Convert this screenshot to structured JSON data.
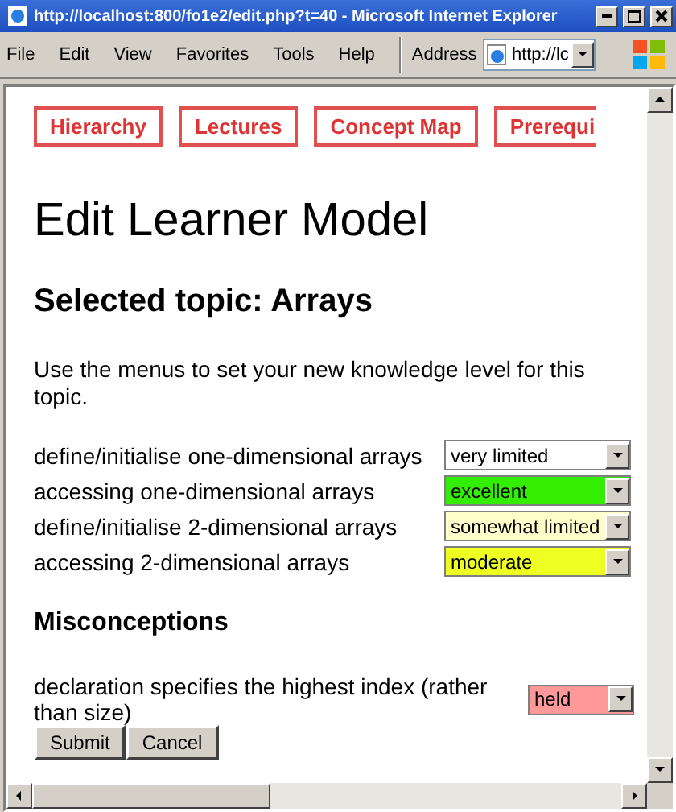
{
  "window": {
    "title": "http://localhost:800/fo1e2/edit.php?t=40 - Microsoft Internet Explorer"
  },
  "menu": [
    "File",
    "Edit",
    "View",
    "Favorites",
    "Tools",
    "Help"
  ],
  "address": {
    "label": "Address",
    "value": "http://lc"
  },
  "nav_tabs": [
    {
      "label": "Hierarchy",
      "cut": false
    },
    {
      "label": "Lectures",
      "cut": false
    },
    {
      "label": "Concept Map",
      "cut": false
    },
    {
      "label": "Prerequi",
      "cut": true
    }
  ],
  "heading": "Edit Learner Model",
  "subheading": "Selected topic: Arrays",
  "instructions": "Use the menus to set your new knowledge level for this topic.",
  "topics": [
    {
      "label": "define/initialise one-dimensional arrays",
      "value": "very limited",
      "color": "#ffffff"
    },
    {
      "label": "accessing one-dimensional arrays",
      "value": "excellent",
      "color": "#33ee00"
    },
    {
      "label": "define/initialise 2-dimensional arrays",
      "value": "somewhat limited",
      "color": "#ffffcc"
    },
    {
      "label": "accessing 2-dimensional arrays",
      "value": "moderate",
      "color": "#eeff22"
    }
  ],
  "misconceptions": {
    "title": "Misconceptions",
    "items": [
      {
        "label": "declaration specifies the highest index (rather than size)",
        "value": "held",
        "color": "#ff9999"
      }
    ]
  },
  "buttons": [
    "Submit",
    "Cancel"
  ]
}
